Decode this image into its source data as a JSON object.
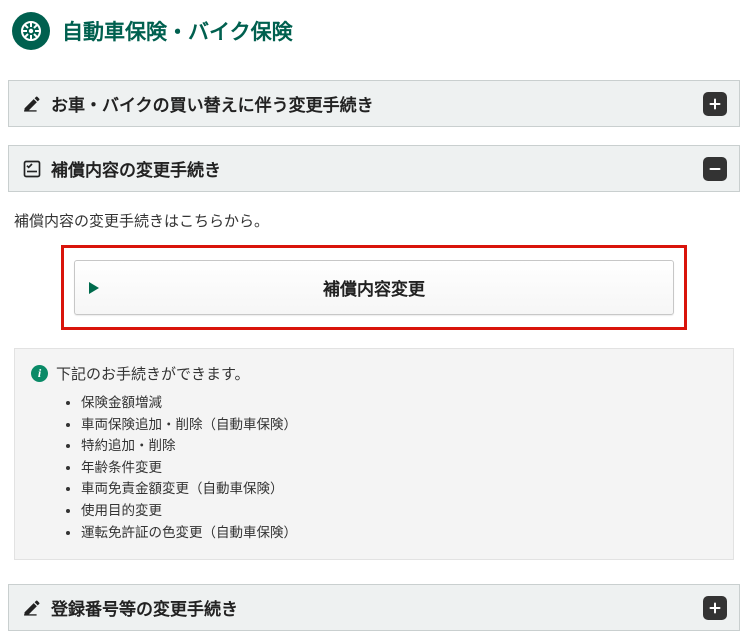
{
  "header": {
    "title": "自動車保険・バイク保険"
  },
  "accordions": {
    "replace": {
      "title": "お車・バイクの買い替えに伴う変更手続き",
      "expanded": false
    },
    "coverage": {
      "title": "補償内容の変更手続き",
      "expanded": true,
      "intro": "補償内容の変更手続きはこちらから。",
      "cta_label": "補償内容変更",
      "info_lead": "下記のお手続きができます。",
      "info_items": [
        "保険金額増減",
        "車両保険追加・削除（自動車保険）",
        "特約追加・削除",
        "年齢条件変更",
        "車両免責金額変更（自動車保険）",
        "使用目的変更",
        "運転免許証の色変更（自動車保険）"
      ]
    },
    "registration": {
      "title": "登録番号等の変更手続き",
      "expanded": false
    }
  }
}
